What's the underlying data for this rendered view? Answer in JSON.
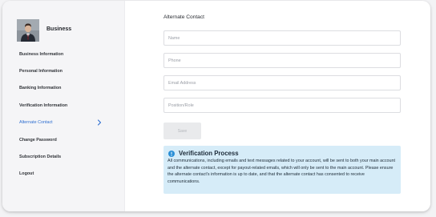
{
  "profile": {
    "business_name": "Business"
  },
  "sidebar": {
    "items": [
      {
        "label": "Business Information",
        "active": false
      },
      {
        "label": "Personal Information",
        "active": false
      },
      {
        "label": "Banking Information",
        "active": false
      },
      {
        "label": "Verification Information",
        "active": false
      },
      {
        "label": "Alternate Contact",
        "active": true
      },
      {
        "label": "Change Password",
        "active": false
      },
      {
        "label": "Subscription Details",
        "active": false
      },
      {
        "label": "Logout",
        "active": false
      }
    ]
  },
  "form": {
    "title": "Alternate Contact",
    "fields": {
      "name": {
        "value": "",
        "placeholder": "Name"
      },
      "phone": {
        "value": "",
        "placeholder": "Phone"
      },
      "email": {
        "value": "",
        "placeholder": "Email Address"
      },
      "position": {
        "value": "",
        "placeholder": "Position/Role"
      }
    },
    "save_label": "Save"
  },
  "info": {
    "title": "Verification Process",
    "text": "All communications, including emails and text messages related to your account, will be sent to both your main account and the alternate contact, except for payout-related emails, which will only be sent to the main account. Please ensure the alternate contact's information is up to date, and that the alternate contact has consented to receive communications."
  },
  "colors": {
    "accent": "#2f6fd0",
    "info_background": "#d6ecf8",
    "info_icon": "#2a8fd6",
    "sidebar_background": "#f5f5f7"
  },
  "icons": {
    "avatar": "business-avatar-photo",
    "active_chevron": "chevron-right-icon",
    "info": "info-circle-icon"
  }
}
